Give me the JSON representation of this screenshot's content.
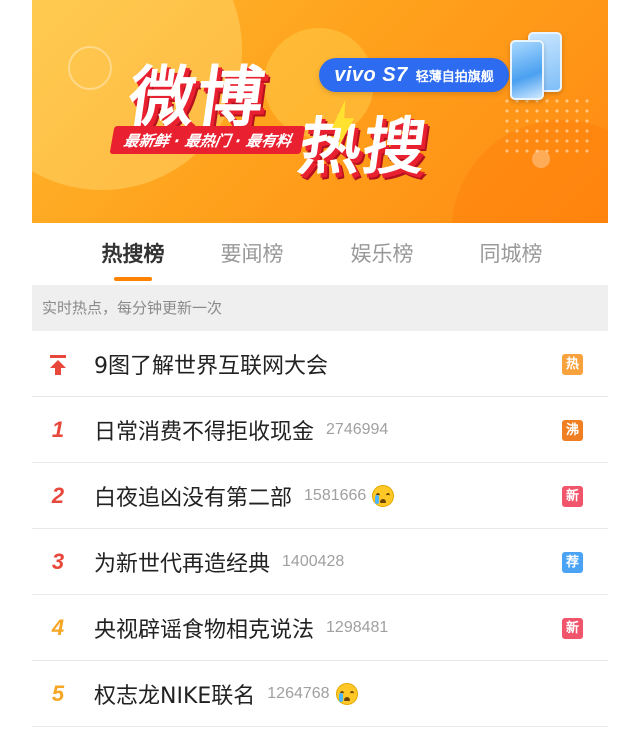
{
  "colors": {
    "accent": "#ff8200",
    "rank_top": "#e8473b",
    "rank_orange": "#f5a623",
    "badge_hot": "#f7a23c",
    "badge_boil": "#f07e23",
    "badge_new": "#f0556b",
    "badge_recommend": "#4aa3f5"
  },
  "banner": {
    "logo_top": "微博",
    "logo_bottom": "热搜",
    "tagline": "最新鲜 · 最热门 · 最有料",
    "sponsor_brand": "vivo S7",
    "sponsor_slogan": "轻薄自拍旗舰"
  },
  "tabs": [
    {
      "label": "热搜榜",
      "active": true
    },
    {
      "label": "要闻榜",
      "active": false
    },
    {
      "label": "娱乐榜",
      "active": false
    },
    {
      "label": "同城榜",
      "active": false
    }
  ],
  "notice": "实时热点，每分钟更新一次",
  "list": [
    {
      "rank": "",
      "pinned": true,
      "title": "9图了解世界互联网大会",
      "count": "",
      "emoji": false,
      "badge": "热",
      "badge_type": "hot",
      "rank_color": "rank_top"
    },
    {
      "rank": "1",
      "pinned": false,
      "title": "日常消费不得拒收现金",
      "count": "2746994",
      "emoji": false,
      "badge": "沸",
      "badge_type": "boil",
      "rank_color": "rank_top"
    },
    {
      "rank": "2",
      "pinned": false,
      "title": "白夜追凶没有第二部",
      "count": "1581666",
      "emoji": true,
      "emoji_name": "crying-face-icon",
      "badge": "新",
      "badge_type": "new",
      "rank_color": "rank_top"
    },
    {
      "rank": "3",
      "pinned": false,
      "title": "为新世代再造经典",
      "count": "1400428",
      "emoji": false,
      "badge": "荐",
      "badge_type": "recommend",
      "rank_color": "rank_top"
    },
    {
      "rank": "4",
      "pinned": false,
      "title": "央视辟谣食物相克说法",
      "count": "1298481",
      "emoji": false,
      "badge": "新",
      "badge_type": "new",
      "rank_color": "rank_orange"
    },
    {
      "rank": "5",
      "pinned": false,
      "title": "权志龙NIKE联名",
      "count": "1264768",
      "emoji": true,
      "emoji_name": "crying-face-icon",
      "badge": "",
      "badge_type": "",
      "rank_color": "rank_orange"
    }
  ]
}
